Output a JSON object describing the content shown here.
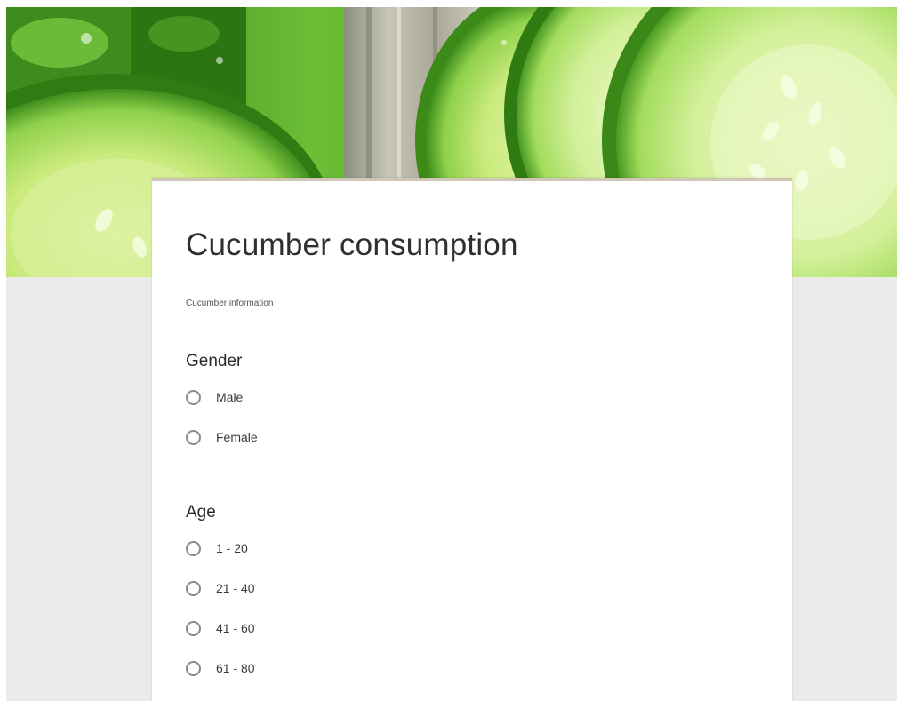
{
  "form": {
    "title": "Cucumber consumption",
    "description": "Cucumber information",
    "questions": [
      {
        "title": "Gender",
        "options": [
          "Male",
          "Female"
        ]
      },
      {
        "title": "Age",
        "options": [
          "1 - 20",
          "21 - 40",
          "41 - 60",
          "61 - 80"
        ]
      }
    ]
  },
  "colors": {
    "page_background": "#ecebe9",
    "card_background": "#ffffff",
    "card_top_border": "#cfc6b6",
    "radio_border": "#8a8a8a",
    "banner_green": "#4f9c2a"
  },
  "icons": {
    "radio": "radio-unchecked-icon"
  }
}
